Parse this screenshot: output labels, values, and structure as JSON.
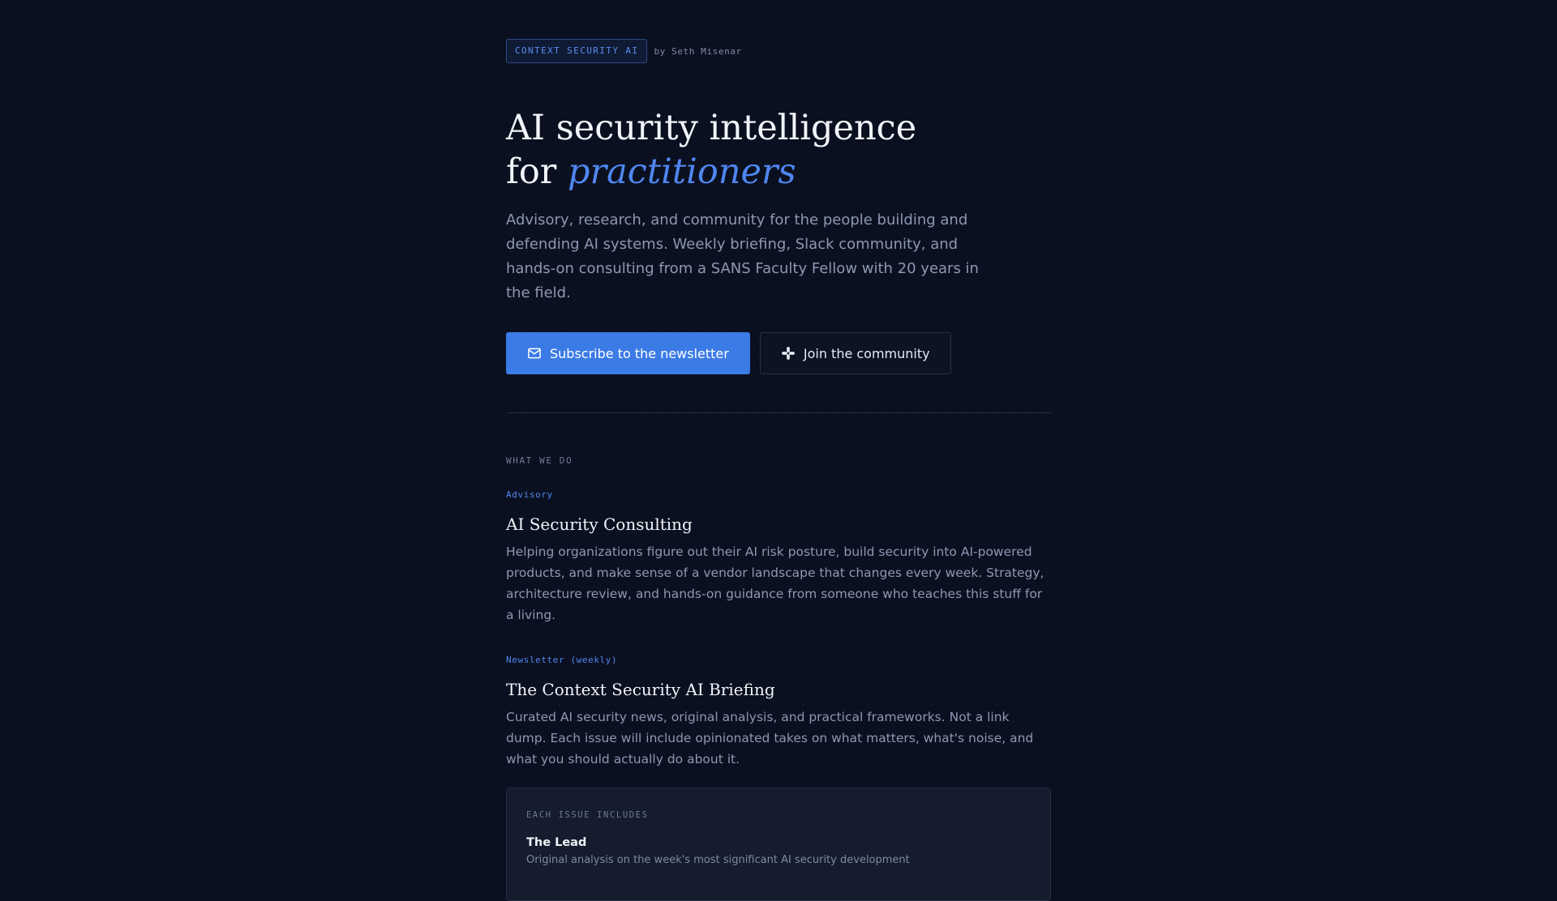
{
  "header": {
    "brand": "CONTEXT SECURITY AI",
    "byline": "by Seth Misenar"
  },
  "hero": {
    "title_line1": "AI security intelligence",
    "title_line2_prefix": "for ",
    "title_line2_accent": "practitioners",
    "lead": "Advisory, research, and community for the people building and defending AI systems. Weekly briefing, Slack community, and hands-on consulting from a SANS Faculty Fellow with 20 years in the field."
  },
  "cta": {
    "primary_label": "Subscribe to the newsletter",
    "primary_icon": "mail-icon",
    "secondary_label": "Join the community",
    "secondary_icon": "slack-icon"
  },
  "what_we_do": {
    "section_label": "WHAT WE DO",
    "offerings": [
      {
        "tag": "Advisory",
        "title": "AI Security Consulting",
        "description": "Helping organizations figure out their AI risk posture, build security into AI-powered products, and make sense of a vendor landscape that changes every week. Strategy, architecture review, and hands-on guidance from someone who teaches this stuff for a living."
      },
      {
        "tag": "Newsletter (weekly)",
        "title": "The Context Security AI Briefing",
        "description": "Curated AI security news, original analysis, and practical frameworks. Not a link dump. Each issue will include opinionated takes on what matters, what's noise, and what you should actually do about it."
      }
    ]
  },
  "issue_card": {
    "label": "EACH ISSUE INCLUDES",
    "items": [
      {
        "title": "The Lead",
        "description": "Original analysis on the week's most significant AI security development"
      }
    ]
  },
  "colors": {
    "background": "#0b1020",
    "accent": "#3b7be6",
    "accent_text": "#4f86f0",
    "muted_text": "#8d98b2"
  }
}
